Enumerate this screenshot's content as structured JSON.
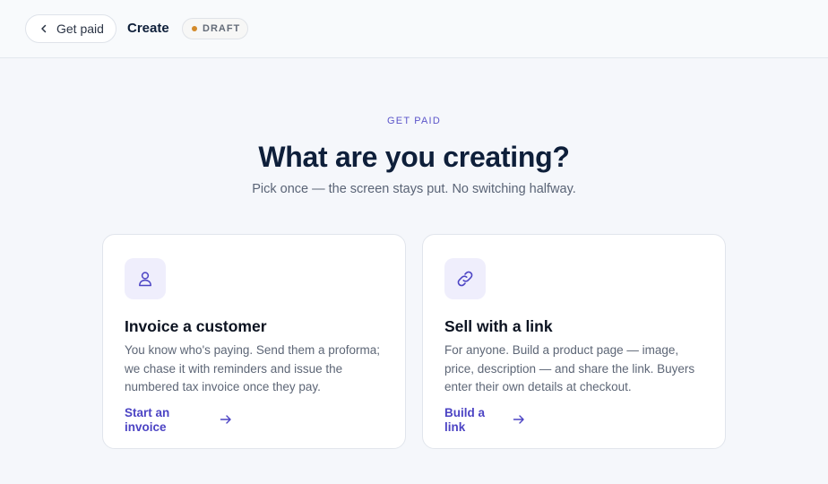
{
  "header": {
    "back_label": "Get paid",
    "page_title": "Create",
    "status_badge": "DRAFT",
    "status_color": "#d38a2a"
  },
  "intro": {
    "eyebrow": "GET PAID",
    "headline": "What are you creating?",
    "subhead": "Pick once — the screen stays put. No switching halfway."
  },
  "options": [
    {
      "icon": "person-icon",
      "title": "Invoice a customer",
      "description": "You know who's paying. Send them a proforma; we chase it with reminders and issue the numbered tax invoice once they pay.",
      "cta": "Start an invoice"
    },
    {
      "icon": "link-icon",
      "title": "Sell with a link",
      "description": "For anyone. Build a product page — image, price, description — and share the link. Buyers enter their own details at checkout.",
      "cta": "Build a link"
    }
  ],
  "colors": {
    "accent": "#4c44c4",
    "icon_tile": "#efeefc",
    "background": "#f5f7fb"
  }
}
